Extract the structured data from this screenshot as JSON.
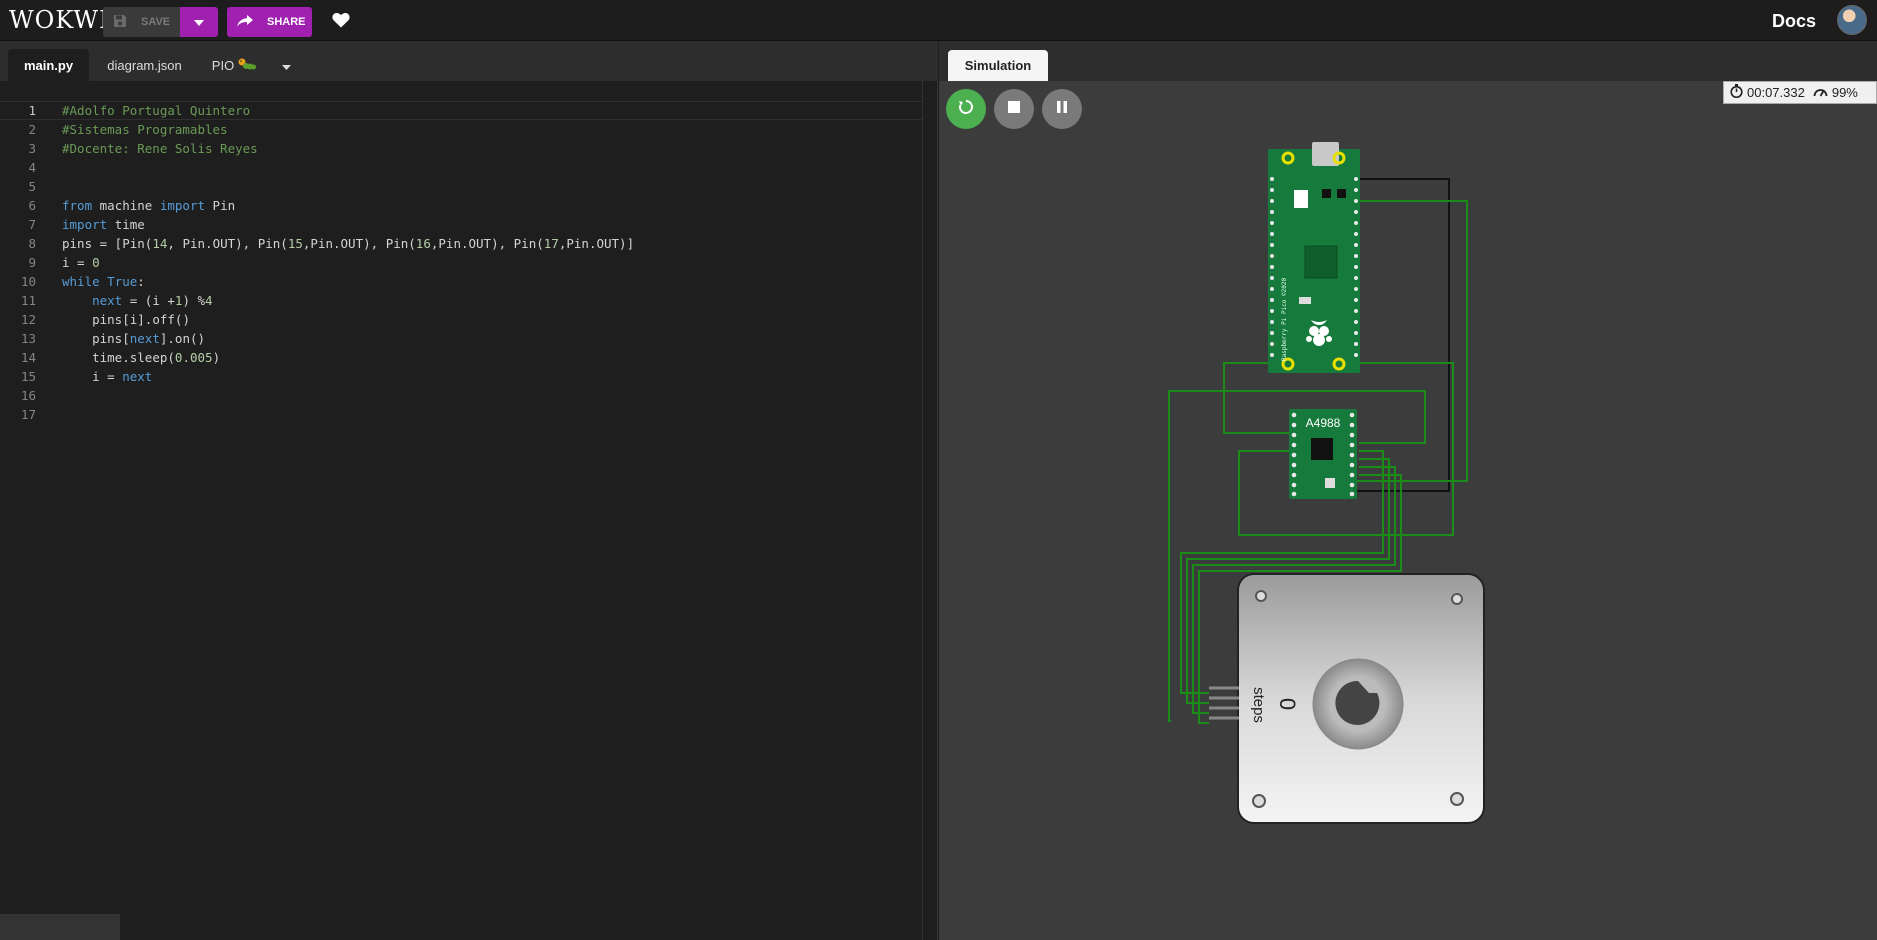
{
  "header": {
    "logo": "WOKWI",
    "save_label": "SAVE",
    "share_label": "SHARE",
    "docs_label": "Docs"
  },
  "editor": {
    "tabs": [
      {
        "label": "main.py",
        "active": true
      },
      {
        "label": "diagram.json",
        "active": false
      },
      {
        "label": "PIO",
        "active": false
      }
    ],
    "current_line": 1,
    "lines": [
      {
        "n": "1",
        "code": "#Adolfo Portugal Quintero"
      },
      {
        "n": "2",
        "code": "#Sistemas Programables"
      },
      {
        "n": "3",
        "code": "#Docente: Rene Solis Reyes"
      },
      {
        "n": "4",
        "code": ""
      },
      {
        "n": "5",
        "code": ""
      },
      {
        "n": "6",
        "code": "from machine import Pin"
      },
      {
        "n": "7",
        "code": "import time"
      },
      {
        "n": "8",
        "code": "pins = [Pin(14, Pin.OUT), Pin(15,Pin.OUT), Pin(16,Pin.OUT), Pin(17,Pin.OUT)]"
      },
      {
        "n": "9",
        "code": "i = 0"
      },
      {
        "n": "10",
        "code": "while True:"
      },
      {
        "n": "11",
        "code": "    next = (i +1) %4"
      },
      {
        "n": "12",
        "code": "    pins[i].off()"
      },
      {
        "n": "13",
        "code": "    pins[next].on()"
      },
      {
        "n": "14",
        "code": "    time.sleep(0.005)"
      },
      {
        "n": "15",
        "code": "    i = next"
      },
      {
        "n": "16",
        "code": ""
      },
      {
        "n": "17",
        "code": ""
      }
    ]
  },
  "simulation": {
    "tab_label": "Simulation",
    "elapsed": "00:07.332",
    "speed": "99%",
    "driver_label": "A4988",
    "stepper_value": "0",
    "stepper_unit": "steps",
    "pico_silkscreen": "Raspberry Pi Pico ©2020",
    "accent_green": "#4caf50",
    "wire_green": "#1a8c1a"
  }
}
